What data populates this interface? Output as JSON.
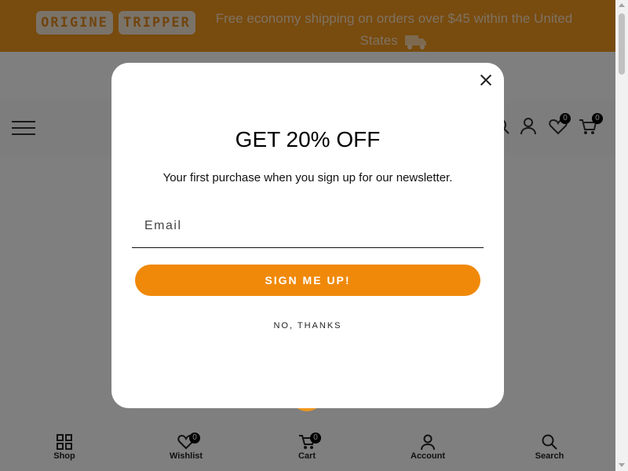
{
  "announcement": {
    "logo_left": "ORIGINE",
    "logo_right": "TRIPPER",
    "text": "Free economy shipping on orders over $45 within the United States",
    "icon": "truck-icon"
  },
  "header": {
    "menu_icon": "hamburger-menu-icon",
    "wishlist_count": "0",
    "cart_count": "0"
  },
  "popup": {
    "title": "GET 20% OFF",
    "subtitle": "Your first purchase when you sign up for our newsletter.",
    "email_placeholder": "Email",
    "submit_label": "SIGN ME UP!",
    "dismiss_label": "NO, THANKS",
    "accent_color": "#f0890a"
  },
  "bottom_nav": {
    "items": [
      {
        "label": "Shop",
        "icon": "grid-icon"
      },
      {
        "label": "Wishlist",
        "icon": "heart-icon",
        "badge": "0"
      },
      {
        "label": "Cart",
        "icon": "cart-icon",
        "badge": "0"
      },
      {
        "label": "Account",
        "icon": "user-icon"
      },
      {
        "label": "Search",
        "icon": "search-icon"
      }
    ]
  },
  "colors": {
    "brand_orange": "#f0961e"
  }
}
